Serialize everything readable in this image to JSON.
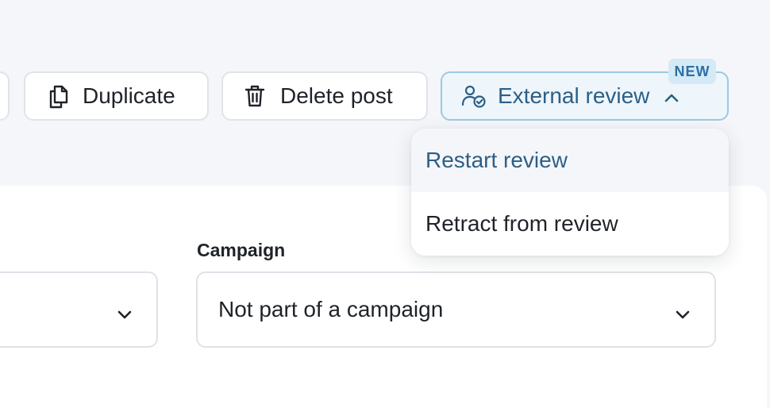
{
  "toolbar": {
    "duplicate_label": "Duplicate",
    "delete_label": "Delete post",
    "external_review_label": "External review",
    "new_badge": "NEW"
  },
  "review_menu": {
    "items": [
      {
        "label": "Restart review"
      },
      {
        "label": "Retract from review"
      }
    ]
  },
  "form": {
    "campaign_label": "Campaign",
    "campaign_value": "Not part of a campaign"
  },
  "colors": {
    "accent": "#2c5f86",
    "accent_border": "#9cc9e2",
    "badge_bg": "#d5eaf7",
    "page_bg": "#f5f6f9"
  },
  "icons": {
    "duplicate": "copy-icon",
    "delete": "trash-icon",
    "external_review": "user-check-icon",
    "dropdown": "chevron-down-icon",
    "collapse": "chevron-up-icon"
  }
}
